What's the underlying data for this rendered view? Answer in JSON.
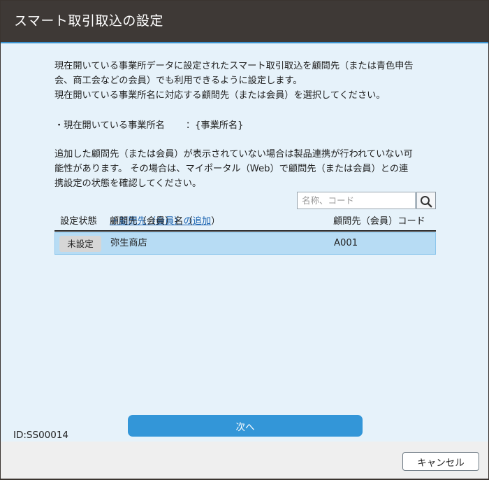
{
  "dialog": {
    "title": "スマート取引取込の設定"
  },
  "intro": {
    "line1": "現在開いている事業所データに設定されたスマート取引取込を顧問先（または青色申告",
    "line2": "会、商工会などの会員）でも利用できるように設定します。",
    "line3": "現在開いている事業所名に対応する顧問先（または会員）を選択してください。"
  },
  "office": {
    "label": "・現在開いている事業所名",
    "value": "：{事業所名}"
  },
  "notice": {
    "line1": "追加した顧問先（または会員）が表示されていない場合は製品連携が行われていない可",
    "line2": "能性があります。 その場合は、マイポータル（Web）で顧問先（または会員）との連",
    "line3": "携設定の状態を確認してください。"
  },
  "search": {
    "placeholder": "名称、コード",
    "icon": "search-icon"
  },
  "table": {
    "headers": {
      "status": "設定状態",
      "name_prefix": "顧問先（会員）名（",
      "add_link": "＋顧問先（会員）の追加",
      "name_suffix": "）",
      "code": "顧問先（会員）コード"
    },
    "rows": [
      {
        "status": "未設定",
        "name": "弥生商店",
        "code": "A001"
      }
    ]
  },
  "buttons": {
    "next": "次へ",
    "cancel": "キャンセル"
  },
  "screen_id": "ID:SS00014",
  "colors": {
    "titlebar": "#3e3936",
    "accent": "#3396d8",
    "content_bg": "#e6f2fa",
    "selected_row": "#b7dcf4",
    "link": "#1a63b0"
  }
}
